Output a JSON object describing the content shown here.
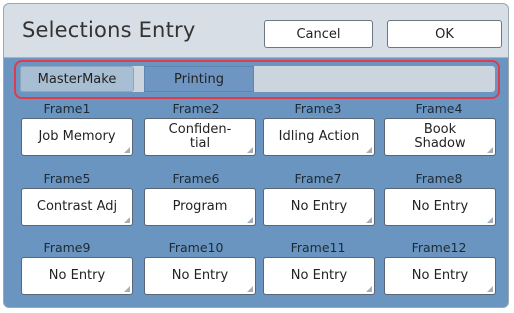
{
  "header": {
    "title": "Selections Entry",
    "cancel_label": "Cancel",
    "ok_label": "OK"
  },
  "tabs": [
    {
      "label": "MasterMake",
      "selected": false
    },
    {
      "label": "Printing",
      "selected": true
    }
  ],
  "frames": [
    {
      "label": "Frame1",
      "value": "Job Memory"
    },
    {
      "label": "Frame2",
      "value": "Confiden-\ntial"
    },
    {
      "label": "Frame3",
      "value": "Idling Action"
    },
    {
      "label": "Frame4",
      "value": "Book\nShadow"
    },
    {
      "label": "Frame5",
      "value": "Contrast Adj"
    },
    {
      "label": "Frame6",
      "value": "Program"
    },
    {
      "label": "Frame7",
      "value": "No Entry"
    },
    {
      "label": "Frame8",
      "value": "No Entry"
    },
    {
      "label": "Frame9",
      "value": "No Entry"
    },
    {
      "label": "Frame10",
      "value": "No Entry"
    },
    {
      "label": "Frame11",
      "value": "No Entry"
    },
    {
      "label": "Frame12",
      "value": "No Entry"
    }
  ],
  "colors": {
    "panel_bg": "#6a95c0",
    "header_bg": "#d8dee5",
    "highlight_outline": "#e03a4b",
    "selected_tab": "#6f95c2"
  }
}
